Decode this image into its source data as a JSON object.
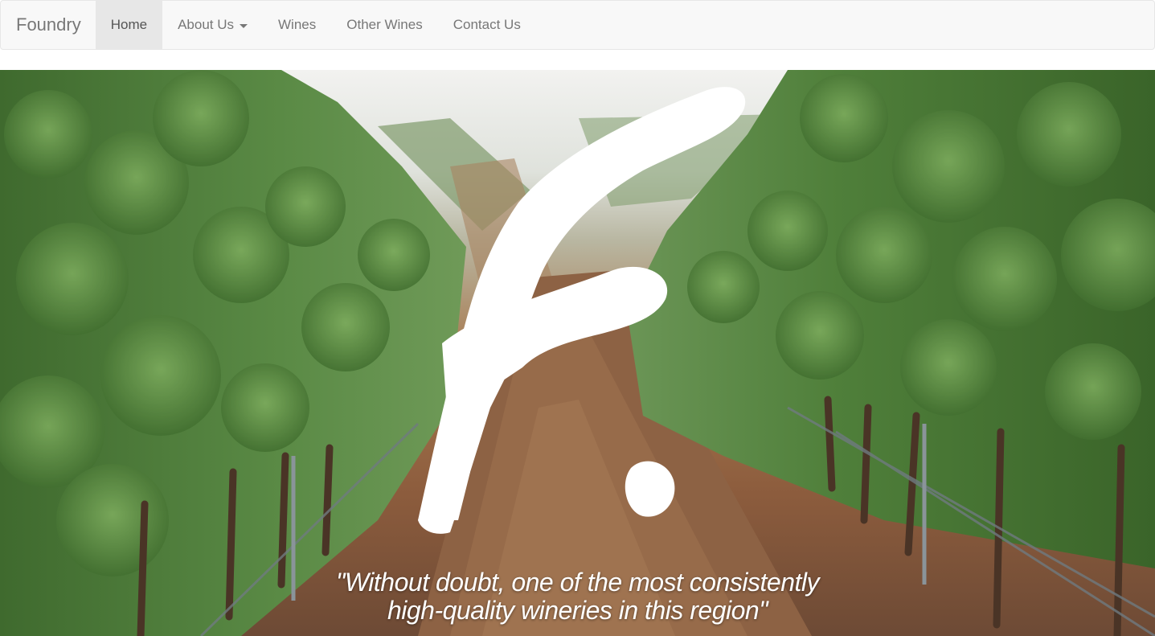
{
  "navbar": {
    "brand": "Foundry",
    "items": [
      {
        "label": "Home",
        "active": true
      },
      {
        "label": "About Us",
        "dropdown": true
      },
      {
        "label": "Wines"
      },
      {
        "label": "Other Wines"
      },
      {
        "label": "Contact Us"
      }
    ]
  },
  "hero": {
    "quote_line1": "\"Without doubt, one of the most consistently",
    "quote_line2": "high-quality wineries in this region\"",
    "logo": "foundry-f-brush-logo-icon"
  },
  "colors": {
    "navbar_bg": "#f8f8f8",
    "active_bg": "#e7e7e7",
    "nav_text": "#777777",
    "foliage": "#4f7a3a",
    "soil": "#8a5a3c"
  }
}
